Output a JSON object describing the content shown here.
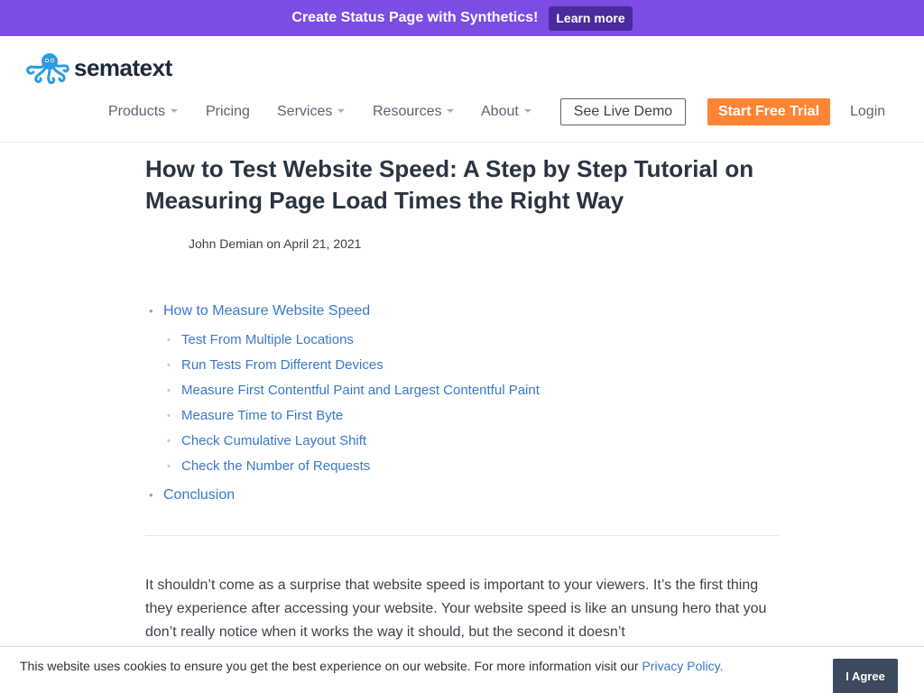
{
  "promo": {
    "text": "Create Status Page with Synthetics!",
    "button_label": "Learn more"
  },
  "header": {
    "logo_text": "sematext",
    "logo_icon": "octopus-icon",
    "nav": [
      {
        "label": "Products",
        "dropdown": true
      },
      {
        "label": "Pricing",
        "dropdown": false
      },
      {
        "label": "Services",
        "dropdown": true
      },
      {
        "label": "Resources",
        "dropdown": true
      },
      {
        "label": "About",
        "dropdown": true
      }
    ],
    "demo_label": "See Live Demo",
    "trial_label": "Start Free Trial",
    "login_label": "Login"
  },
  "article": {
    "title": "How to Test Website Speed: A Step by Step Tutorial on Measuring Page Load Times the Right Way",
    "byline": "John Demian on April 21, 2021",
    "toc": {
      "main_1": "How to Measure Website Speed",
      "subs": [
        "Test From Multiple Locations",
        "Run Tests From Different Devices",
        "Measure First Contentful Paint and Largest Contentful Paint",
        "Measure Time to First Byte",
        "Check Cumulative Layout Shift",
        "Check the Number of Requests"
      ],
      "main_2": "Conclusion"
    },
    "intro": "It shouldn’t come as a surprise that website speed is important to your viewers. It’s the first thing they experience after accessing your website. Your website speed is like an unsung hero that you don’t really notice when it works the way it should, but the second it doesn’t"
  },
  "cookie": {
    "text": "This website uses cookies to ensure you get the best experience on our website. For more information visit our ",
    "link_label": "Privacy Policy",
    "suffix": ".",
    "button_label": "I Agree"
  },
  "colors": {
    "promo_bg": "#7b4de3",
    "promo_button": "#4a2a9c",
    "trial_button": "#ff8433",
    "link": "#3a78c9",
    "cookie_button": "#3b4a5e",
    "logo": "#2a9de0"
  }
}
